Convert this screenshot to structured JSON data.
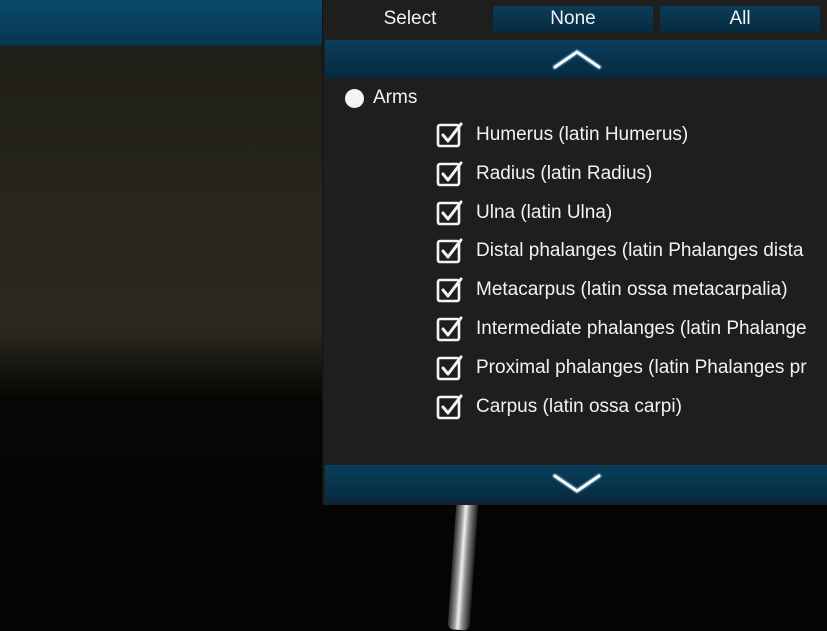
{
  "header": {
    "select_label": "Select",
    "none_button": "None",
    "all_button": "All"
  },
  "group": {
    "label": "Arms",
    "items": [
      {
        "label": "Humerus (latin Humerus)",
        "checked": true
      },
      {
        "label": "Radius (latin Radius)",
        "checked": true
      },
      {
        "label": "Ulna (latin Ulna)",
        "checked": true
      },
      {
        "label": "Distal phalanges (latin Phalanges dista",
        "checked": true
      },
      {
        "label": "Metacarpus (latin ossa metacarpalia)",
        "checked": true
      },
      {
        "label": "Intermediate phalanges (latin Phalange",
        "checked": true
      },
      {
        "label": "Proximal phalanges (latin Phalanges pr",
        "checked": true
      },
      {
        "label": "Carpus (latin ossa carpi)",
        "checked": true
      }
    ]
  },
  "icons": {
    "scroll_up": "chevron-up-icon",
    "scroll_down": "chevron-down-icon",
    "checkbox": "checkbox-checked-icon"
  },
  "colors": {
    "panel_bg": "#1e1e1e",
    "button_blue": "#0b3c58",
    "text": "#f2f2f2"
  }
}
